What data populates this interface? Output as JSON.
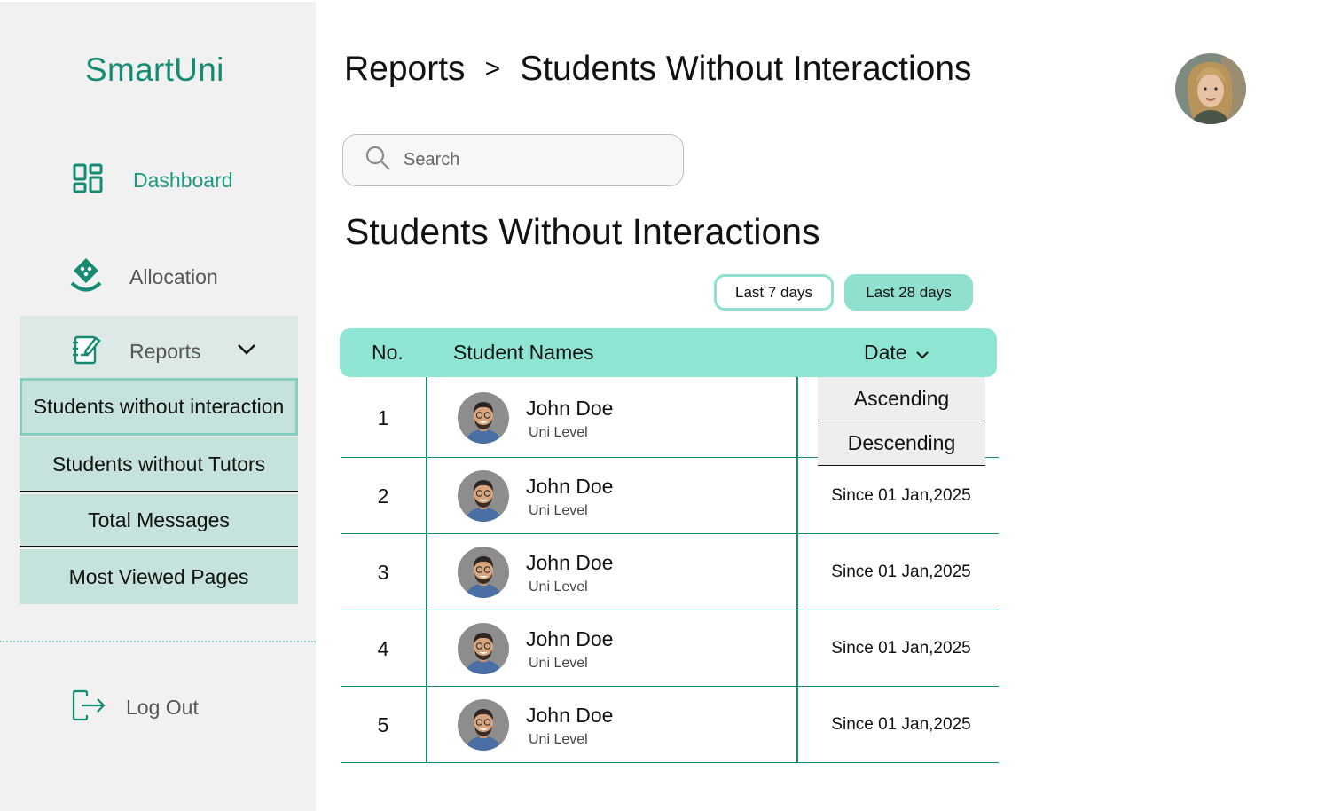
{
  "brand": "SmartUni",
  "nav": {
    "dashboard": "Dashboard",
    "allocation": "Allocation",
    "reports": "Reports",
    "logout": "Log Out"
  },
  "reports_submenu": [
    "Students without interaction",
    "Students without Tutors",
    "Total Messages",
    "Most Viewed Pages"
  ],
  "breadcrumb": {
    "parent": "Reports",
    "separator": ">",
    "current": "Students Without Interactions"
  },
  "search": {
    "placeholder": "Search"
  },
  "section_title": "Students Without Interactions",
  "filters": {
    "last7": "Last 7 days",
    "last28": "Last 28 days",
    "active": "Last 28 days"
  },
  "table": {
    "headers": {
      "no": "No.",
      "name": "Student Names",
      "date": "Date"
    },
    "rows": [
      {
        "no": "1",
        "name": "John Doe",
        "level": "Uni Level",
        "date": ""
      },
      {
        "no": "2",
        "name": "John Doe",
        "level": "Uni Level",
        "date": "Since 01 Jan,2025"
      },
      {
        "no": "3",
        "name": "John Doe",
        "level": "Uni Level",
        "date": "Since 01 Jan,2025"
      },
      {
        "no": "4",
        "name": "John Doe",
        "level": "Uni Level",
        "date": "Since 01 Jan,2025"
      },
      {
        "no": "5",
        "name": "John Doe",
        "level": "Uni Level",
        "date": "Since 01 Jan,2025"
      }
    ]
  },
  "sort_dropdown": {
    "ascending": "Ascending",
    "descending": "Descending"
  },
  "colors": {
    "brand": "#168b73",
    "accent": "#8fe5d4",
    "submenu": "#c5e2dc",
    "sidebar": "#f1f1f1"
  }
}
